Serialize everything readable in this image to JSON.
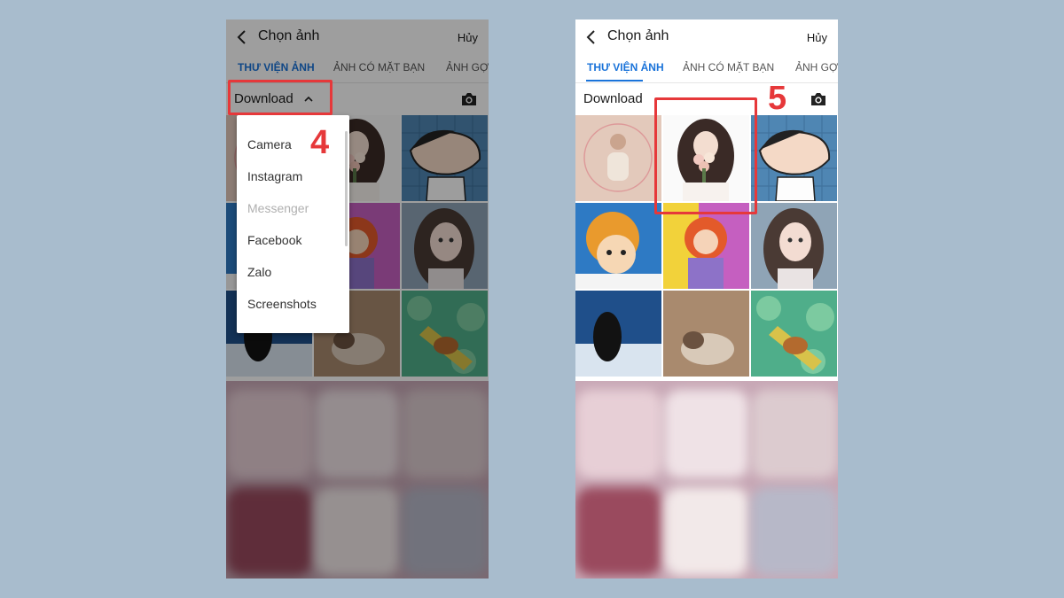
{
  "screens": [
    {
      "header": {
        "title": "Chọn ảnh",
        "cancel_label": "Hủy"
      },
      "tabs": [
        {
          "label": "THƯ VIỆN ẢNH",
          "active": true
        },
        {
          "label": "ẢNH CÓ MẶT BẠN",
          "active": false
        },
        {
          "label": "ẢNH GỢI",
          "active": false
        }
      ],
      "album": {
        "label": "Download",
        "expanded": true
      },
      "dropdown": {
        "items": [
          {
            "label": "Camera",
            "enabled": true
          },
          {
            "label": "Instagram",
            "enabled": true
          },
          {
            "label": "Messenger",
            "enabled": false
          },
          {
            "label": "Facebook",
            "enabled": true
          },
          {
            "label": "Zalo",
            "enabled": true
          },
          {
            "label": "Screenshots",
            "enabled": true
          }
        ]
      },
      "step_label": "4"
    },
    {
      "header": {
        "title": "Chọn ảnh",
        "cancel_label": "Hủy"
      },
      "tabs": [
        {
          "label": "THƯ VIỆN ẢNH",
          "active": true
        },
        {
          "label": "ẢNH CÓ MẶT BẠN",
          "active": false
        },
        {
          "label": "ẢNH GỢI",
          "active": false
        }
      ],
      "album": {
        "label": "Download",
        "expanded": false
      },
      "step_label": "5"
    }
  ],
  "colors": {
    "background": "#a8bccd",
    "accent": "#1a73d9",
    "annotation": "#e6383a"
  },
  "icons": [
    "back-arrow-icon",
    "chevron-up-icon",
    "camera-icon"
  ]
}
